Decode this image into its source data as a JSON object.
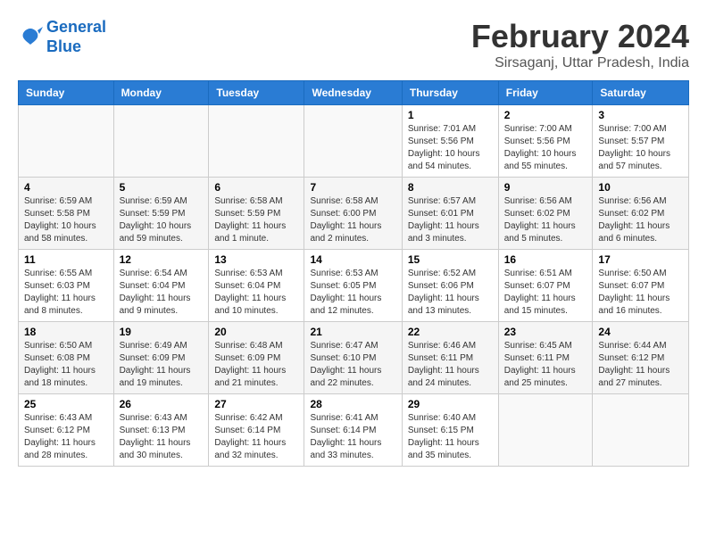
{
  "logo": {
    "line1": "General",
    "line2": "Blue"
  },
  "title": "February 2024",
  "location": "Sirsaganj, Uttar Pradesh, India",
  "headers": [
    "Sunday",
    "Monday",
    "Tuesday",
    "Wednesday",
    "Thursday",
    "Friday",
    "Saturday"
  ],
  "weeks": [
    [
      {
        "day": "",
        "info": ""
      },
      {
        "day": "",
        "info": ""
      },
      {
        "day": "",
        "info": ""
      },
      {
        "day": "",
        "info": ""
      },
      {
        "day": "1",
        "info": "Sunrise: 7:01 AM\nSunset: 5:56 PM\nDaylight: 10 hours\nand 54 minutes."
      },
      {
        "day": "2",
        "info": "Sunrise: 7:00 AM\nSunset: 5:56 PM\nDaylight: 10 hours\nand 55 minutes."
      },
      {
        "day": "3",
        "info": "Sunrise: 7:00 AM\nSunset: 5:57 PM\nDaylight: 10 hours\nand 57 minutes."
      }
    ],
    [
      {
        "day": "4",
        "info": "Sunrise: 6:59 AM\nSunset: 5:58 PM\nDaylight: 10 hours\nand 58 minutes."
      },
      {
        "day": "5",
        "info": "Sunrise: 6:59 AM\nSunset: 5:59 PM\nDaylight: 10 hours\nand 59 minutes."
      },
      {
        "day": "6",
        "info": "Sunrise: 6:58 AM\nSunset: 5:59 PM\nDaylight: 11 hours\nand 1 minute."
      },
      {
        "day": "7",
        "info": "Sunrise: 6:58 AM\nSunset: 6:00 PM\nDaylight: 11 hours\nand 2 minutes."
      },
      {
        "day": "8",
        "info": "Sunrise: 6:57 AM\nSunset: 6:01 PM\nDaylight: 11 hours\nand 3 minutes."
      },
      {
        "day": "9",
        "info": "Sunrise: 6:56 AM\nSunset: 6:02 PM\nDaylight: 11 hours\nand 5 minutes."
      },
      {
        "day": "10",
        "info": "Sunrise: 6:56 AM\nSunset: 6:02 PM\nDaylight: 11 hours\nand 6 minutes."
      }
    ],
    [
      {
        "day": "11",
        "info": "Sunrise: 6:55 AM\nSunset: 6:03 PM\nDaylight: 11 hours\nand 8 minutes."
      },
      {
        "day": "12",
        "info": "Sunrise: 6:54 AM\nSunset: 6:04 PM\nDaylight: 11 hours\nand 9 minutes."
      },
      {
        "day": "13",
        "info": "Sunrise: 6:53 AM\nSunset: 6:04 PM\nDaylight: 11 hours\nand 10 minutes."
      },
      {
        "day": "14",
        "info": "Sunrise: 6:53 AM\nSunset: 6:05 PM\nDaylight: 11 hours\nand 12 minutes."
      },
      {
        "day": "15",
        "info": "Sunrise: 6:52 AM\nSunset: 6:06 PM\nDaylight: 11 hours\nand 13 minutes."
      },
      {
        "day": "16",
        "info": "Sunrise: 6:51 AM\nSunset: 6:07 PM\nDaylight: 11 hours\nand 15 minutes."
      },
      {
        "day": "17",
        "info": "Sunrise: 6:50 AM\nSunset: 6:07 PM\nDaylight: 11 hours\nand 16 minutes."
      }
    ],
    [
      {
        "day": "18",
        "info": "Sunrise: 6:50 AM\nSunset: 6:08 PM\nDaylight: 11 hours\nand 18 minutes."
      },
      {
        "day": "19",
        "info": "Sunrise: 6:49 AM\nSunset: 6:09 PM\nDaylight: 11 hours\nand 19 minutes."
      },
      {
        "day": "20",
        "info": "Sunrise: 6:48 AM\nSunset: 6:09 PM\nDaylight: 11 hours\nand 21 minutes."
      },
      {
        "day": "21",
        "info": "Sunrise: 6:47 AM\nSunset: 6:10 PM\nDaylight: 11 hours\nand 22 minutes."
      },
      {
        "day": "22",
        "info": "Sunrise: 6:46 AM\nSunset: 6:11 PM\nDaylight: 11 hours\nand 24 minutes."
      },
      {
        "day": "23",
        "info": "Sunrise: 6:45 AM\nSunset: 6:11 PM\nDaylight: 11 hours\nand 25 minutes."
      },
      {
        "day": "24",
        "info": "Sunrise: 6:44 AM\nSunset: 6:12 PM\nDaylight: 11 hours\nand 27 minutes."
      }
    ],
    [
      {
        "day": "25",
        "info": "Sunrise: 6:43 AM\nSunset: 6:12 PM\nDaylight: 11 hours\nand 28 minutes."
      },
      {
        "day": "26",
        "info": "Sunrise: 6:43 AM\nSunset: 6:13 PM\nDaylight: 11 hours\nand 30 minutes."
      },
      {
        "day": "27",
        "info": "Sunrise: 6:42 AM\nSunset: 6:14 PM\nDaylight: 11 hours\nand 32 minutes."
      },
      {
        "day": "28",
        "info": "Sunrise: 6:41 AM\nSunset: 6:14 PM\nDaylight: 11 hours\nand 33 minutes."
      },
      {
        "day": "29",
        "info": "Sunrise: 6:40 AM\nSunset: 6:15 PM\nDaylight: 11 hours\nand 35 minutes."
      },
      {
        "day": "",
        "info": ""
      },
      {
        "day": "",
        "info": ""
      }
    ]
  ]
}
